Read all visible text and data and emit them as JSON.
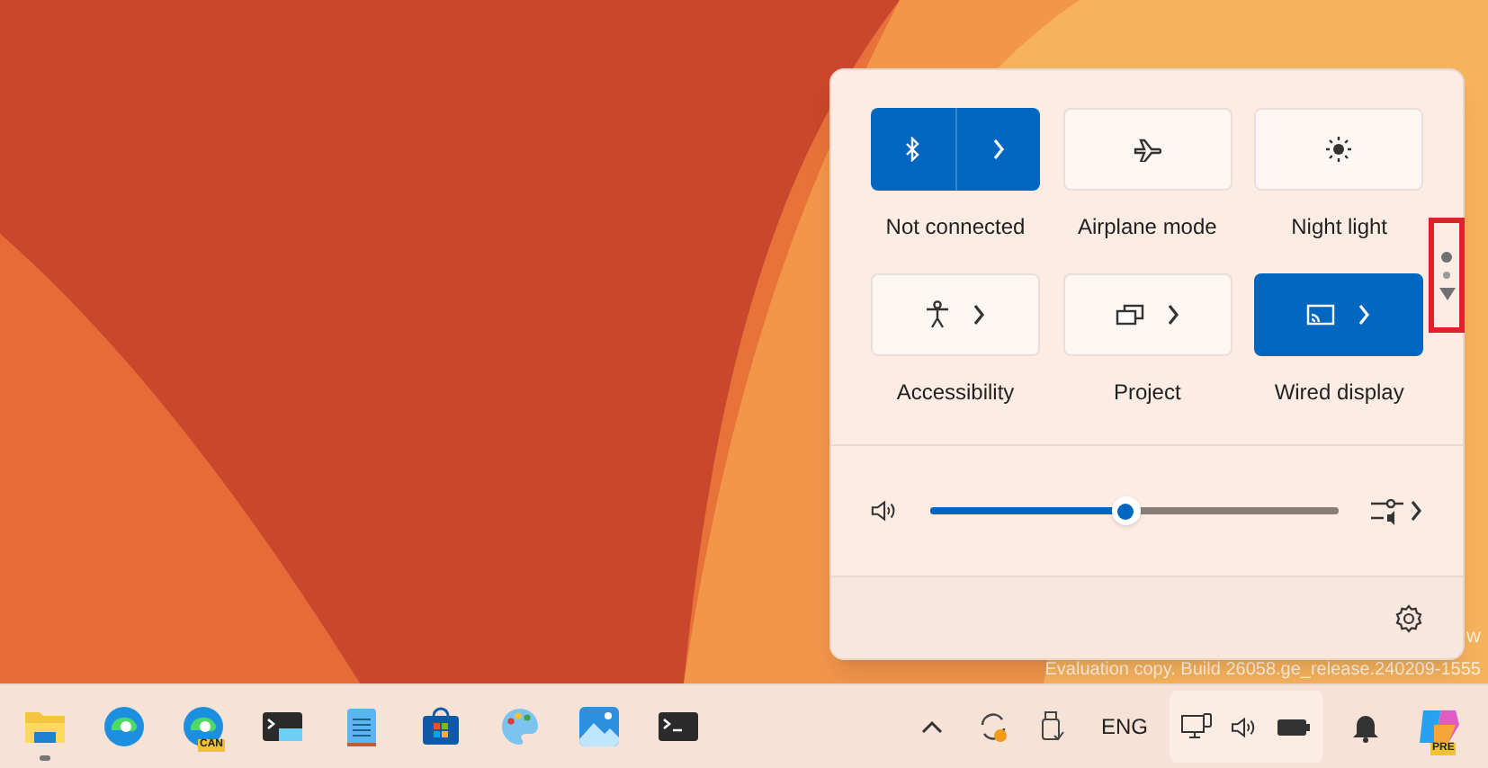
{
  "quick_settings": {
    "tiles": [
      {
        "kind": "split",
        "label": "Not connected",
        "on": true
      },
      {
        "kind": "toggle",
        "label": "Airplane mode",
        "on": false
      },
      {
        "kind": "toggle",
        "label": "Night light",
        "on": false
      },
      {
        "kind": "expand",
        "label": "Accessibility",
        "on": false
      },
      {
        "kind": "expand",
        "label": "Project",
        "on": false
      },
      {
        "kind": "expand",
        "label": "Wired display",
        "on": true
      }
    ],
    "pager": {
      "pages": [
        {
          "selected": true
        },
        {
          "selected": false
        }
      ]
    },
    "volume": {
      "level": 0.48
    }
  },
  "desktop_text": {
    "line_1": "w",
    "line_2": "Evaluation copy. Build 26058.ge_release.240209-1555"
  },
  "taskbar": {
    "apps": [
      {
        "running": true
      },
      {
        "running": false
      },
      {
        "badge": "CAN",
        "running": false
      },
      {
        "running": false
      },
      {
        "running": false
      },
      {
        "running": false
      },
      {
        "running": false
      },
      {
        "running": false
      },
      {
        "running": false
      }
    ],
    "language": "ENG",
    "copilot_badge": "PRE"
  }
}
